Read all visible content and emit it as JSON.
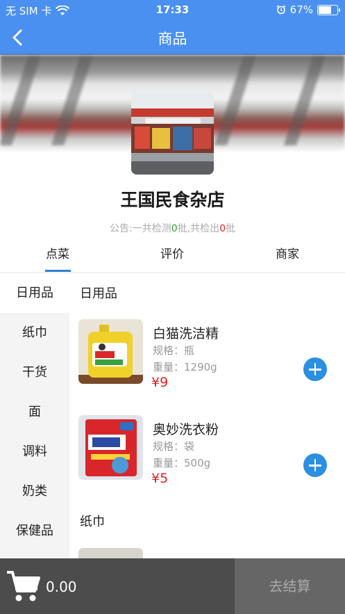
{
  "status_bar": {
    "carrier": "无 SIM 卡",
    "time": "17:33",
    "battery": "67%"
  },
  "navbar": {
    "title": "商品"
  },
  "store": {
    "name": "王国民食杂店",
    "notice_prefix": "公告:一共检测",
    "notice_count1": "0",
    "notice_middle": "批,共检出",
    "notice_count2": "0",
    "notice_suffix": "批"
  },
  "tabs": [
    {
      "label": "点菜"
    },
    {
      "label": "评价"
    },
    {
      "label": "商家"
    }
  ],
  "categories": [
    {
      "label": "日用品"
    },
    {
      "label": "纸巾"
    },
    {
      "label": "干货"
    },
    {
      "label": "面"
    },
    {
      "label": "调料"
    },
    {
      "label": "奶类"
    },
    {
      "label": "保健品"
    }
  ],
  "sections": [
    {
      "title": "日用品",
      "items": [
        {
          "name": "白猫洗洁精",
          "spec": "规格：瓶",
          "weight": "重量：1290g",
          "price": "¥9"
        },
        {
          "name": "奥妙洗衣粉",
          "spec": "规格：袋",
          "weight": "重量：500g",
          "price": "¥5"
        }
      ]
    },
    {
      "title": "纸巾"
    }
  ],
  "cart": {
    "total": "0.00",
    "checkout_label": "去结算"
  },
  "colors": {
    "primary": "#4a90f0",
    "price": "#e02020",
    "add_button": "#2c8fe0"
  }
}
